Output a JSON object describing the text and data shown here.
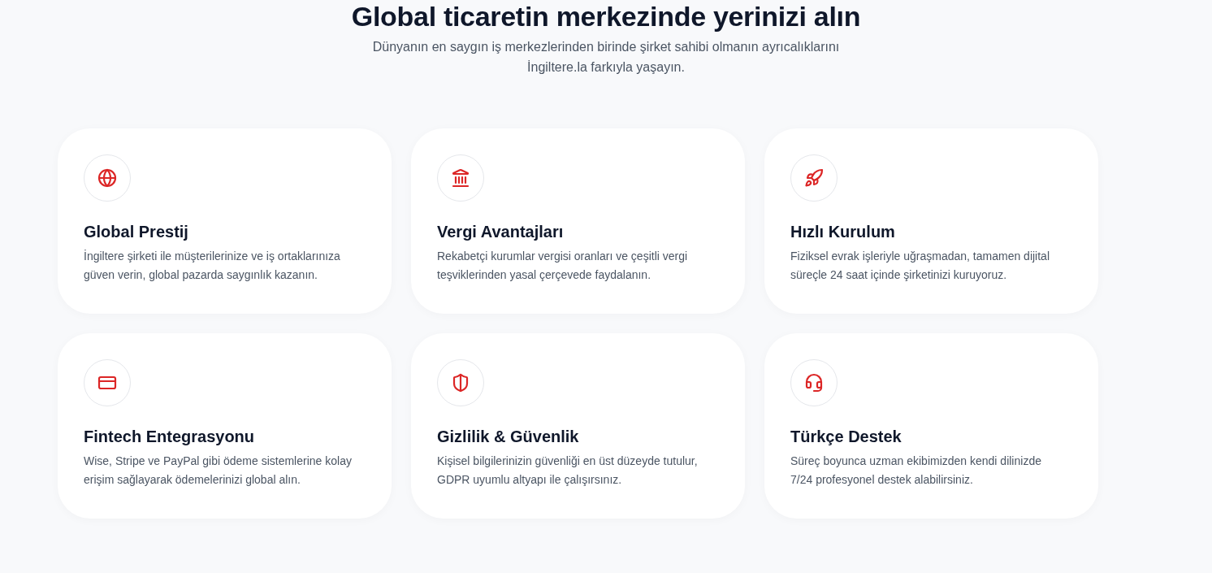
{
  "header": {
    "title": "Global ticaretin merkezinde yerinizi alın",
    "subtitle_lines": [
      "Dünyanın en saygın iş merkezlerinden birinde şirket sahibi olmanın ayrıcalıklarını",
      "İngiltere.la farkıyla yaşayın."
    ]
  },
  "features": [
    {
      "title": "Global Prestij",
      "description": "İngiltere şirketi ile müşterilerinize ve iş ortaklarınıza güven verin, global pazarda saygınlık kazanın."
    },
    {
      "title": "Vergi Avantajları",
      "description": "Rekabetçi kurumlar vergisi oranları ve çeşitli vergi teşviklerinden yasal çerçevede faydalanın."
    },
    {
      "title": "Hızlı Kurulum",
      "description": "Fiziksel evrak işleriyle uğraşmadan, tamamen dijital süreçle 24 saat içinde şirketinizi kuruyoruz."
    },
    {
      "title": "Fintech Entegrasyonu",
      "description": "Wise, Stripe ve PayPal gibi ödeme sistemlerine kolay erişim sağlayarak ödemelerinizi global alın."
    },
    {
      "title": "Gizlilik & Güvenlik",
      "description": "Kişisel bilgilerinizin güvenliği en üst düzeyde tutulur, GDPR uyumlu altyapı ile çalışırsınız."
    },
    {
      "title": "Türkçe Destek",
      "description": "Süreç boyunca uzman ekibimizden kendi dilinizde 7/24 profesyonel destek alabilirsiniz."
    }
  ]
}
